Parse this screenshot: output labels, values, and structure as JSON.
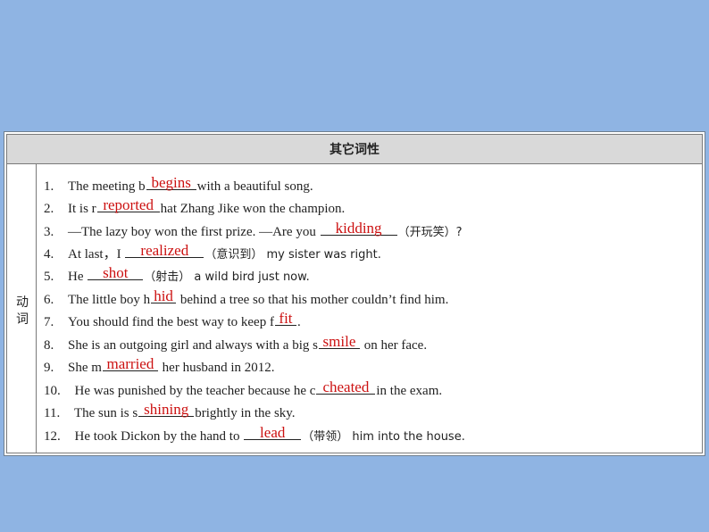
{
  "table": {
    "header": "其它词性",
    "category": "动词"
  },
  "items": [
    {
      "num": "1.",
      "pre": "The meeting b",
      "answer": "begins",
      "post": "with a beautiful song."
    },
    {
      "num": "2.",
      "pre": "It is r",
      "answer": "reported",
      "post": "hat Zhang Jike won the champion."
    },
    {
      "num": "3.",
      "pre": "—The lazy boy won the first prize.  —Are you ",
      "answer": "kidding",
      "post": "（开玩笑）?"
    },
    {
      "num": "4.",
      "pre": "At last，I ",
      "answer": "realized",
      "post": "（意识到） my sister was right."
    },
    {
      "num": "5.",
      "pre": "He ",
      "answer": "shot",
      "post": "（射击） a wild bird just now."
    },
    {
      "num": "6.",
      "pre": "The little boy h",
      "answer": "hid",
      "post": " behind a tree so that his mother couldn’t find him."
    },
    {
      "num": "7.",
      "pre": "You should find the best way to keep f",
      "answer": "fit",
      "post": "."
    },
    {
      "num": "8.",
      "pre": "She is an outgoing girl and always with a big s",
      "answer": "smile",
      "post": " on her face."
    },
    {
      "num": "9.",
      "pre": "She m",
      "answer": "married",
      "post": " her husband in 2012."
    },
    {
      "num": "10.",
      "pre": "He was punished by the teacher because he c",
      "answer": "cheated",
      "post": "in the exam."
    },
    {
      "num": "11.",
      "pre": "The sun is s",
      "answer": "shining",
      "post": "brightly in the sky."
    },
    {
      "num": "12.",
      "pre": "He took Dickon by the hand to ",
      "answer": "lead",
      "post": "（带领） him into the house."
    }
  ]
}
